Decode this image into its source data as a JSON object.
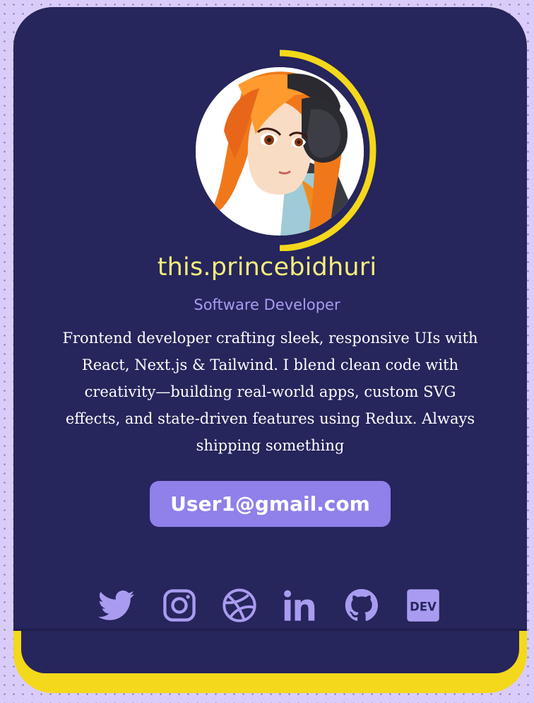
{
  "profile": {
    "handle": "this.princebidhuri",
    "role": "Software Developer",
    "bio": "Frontend developer crafting sleek, responsive UIs with React, Next.js & Tailwind. I blend clean code with creativity—building real-world apps, custom SVG effects, and state-driven features using Redux. Always shipping something",
    "email": "User1@gmail.com"
  },
  "socials": [
    {
      "name": "twitter",
      "icon": "twitter-icon"
    },
    {
      "name": "instagram",
      "icon": "instagram-icon"
    },
    {
      "name": "dribbble",
      "icon": "dribbble-icon"
    },
    {
      "name": "linkedin",
      "icon": "linkedin-icon"
    },
    {
      "name": "github",
      "icon": "github-icon"
    },
    {
      "name": "dev",
      "icon": "dev-icon",
      "label": "DEV"
    }
  ],
  "colors": {
    "page_background": "#d9ccfb",
    "card_background": "#26255c",
    "accent_yellow": "#f4d81b",
    "handle_text": "#f7ef7a",
    "role_text": "#a99cf0",
    "button_background": "#8f80ea",
    "icon_color": "#a99cf0"
  }
}
